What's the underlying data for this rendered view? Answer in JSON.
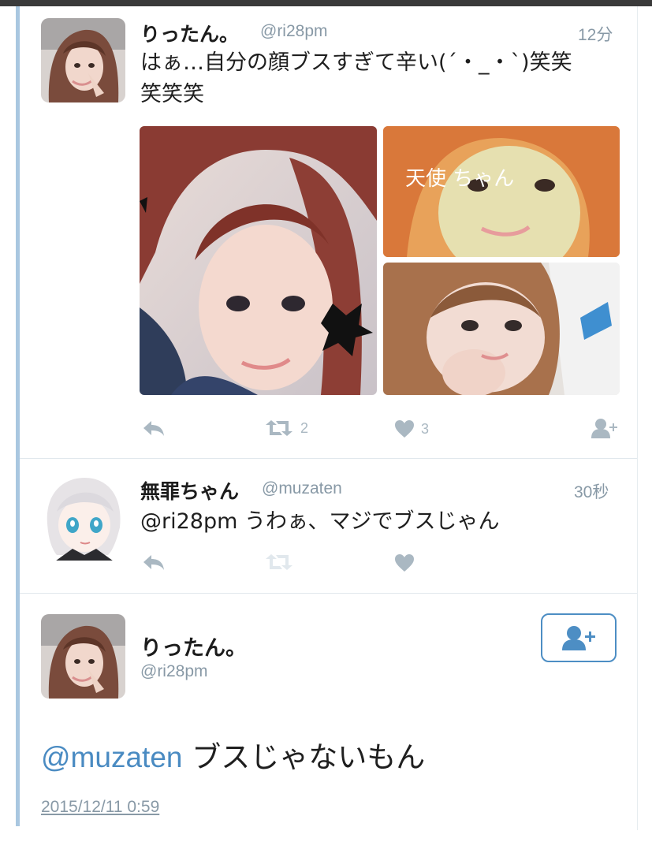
{
  "tweet1": {
    "name": "りったん。",
    "handle": "@ri28pm",
    "time": "12分",
    "text_line1": "はぁ…自分の顔ブスすぎて辛い(´・_・`)笑笑",
    "text_line2": "笑笑笑",
    "media_caption": "天使 ちゃん",
    "actions": {
      "retweet_count": "2",
      "like_count": "3"
    }
  },
  "reply": {
    "name": "無罪ちゃん",
    "handle": "@muzaten",
    "time": "30秒",
    "text": "@ri28pm うわぁ、マジでブスじゃん"
  },
  "focus": {
    "name": "りったん。",
    "handle": "@ri28pm",
    "mention": "@muzaten",
    "text": " ブスじゃないもん",
    "date": "2015/12/11 0:59"
  },
  "colors": {
    "accent": "#4d8ec4",
    "muted": "#8899a6",
    "icon": "#aab8c2",
    "thread_bar": "#a9c7e0"
  },
  "icons": [
    "reply-icon",
    "retweet-icon",
    "heart-icon",
    "follow-icon"
  ]
}
